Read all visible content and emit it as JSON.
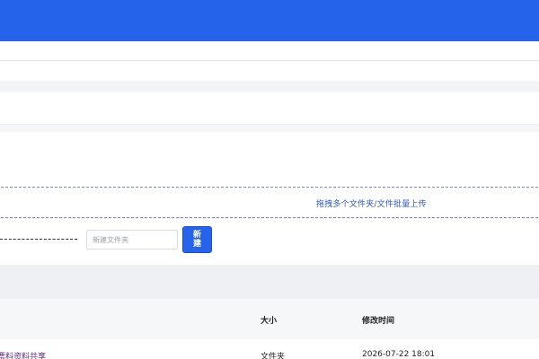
{
  "colors": {
    "header": "#2563eb",
    "accent": "#2563eb",
    "link_visited": "#5b2d8a",
    "dropzone_border": "#7c83d6"
  },
  "upload": {
    "drop_label": "拖拽多个文件夹/文件批量上传"
  },
  "new_folder": {
    "placeholder": "新建文件夹",
    "button_label": "新建"
  },
  "table": {
    "headers": {
      "size": "大小",
      "mtime": "修改时间"
    },
    "rows": [
      {
        "name": "票料资料共享",
        "size": "文件夹",
        "mtime": "2026-07-22 18:01"
      }
    ]
  }
}
